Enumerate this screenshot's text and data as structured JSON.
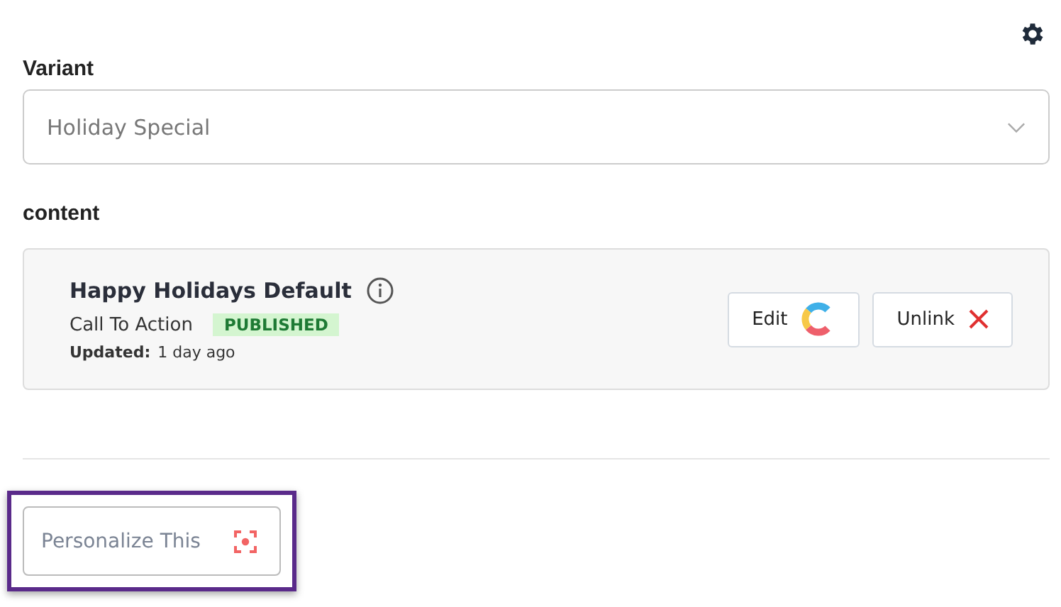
{
  "variant": {
    "label": "Variant",
    "value": "Holiday Special"
  },
  "content": {
    "heading": "content",
    "entry": {
      "title": "Happy Holidays Default",
      "type": "Call To Action",
      "status": {
        "label": "PUBLISHED"
      },
      "updated_label": "Updated:",
      "updated_value": "1 day ago"
    },
    "buttons": [
      {
        "label": "Edit",
        "kind": "edit"
      },
      {
        "label": "Unlink",
        "kind": "unlink"
      }
    ]
  },
  "personalize": {
    "label": "Personalize This",
    "highlighted": true
  }
}
